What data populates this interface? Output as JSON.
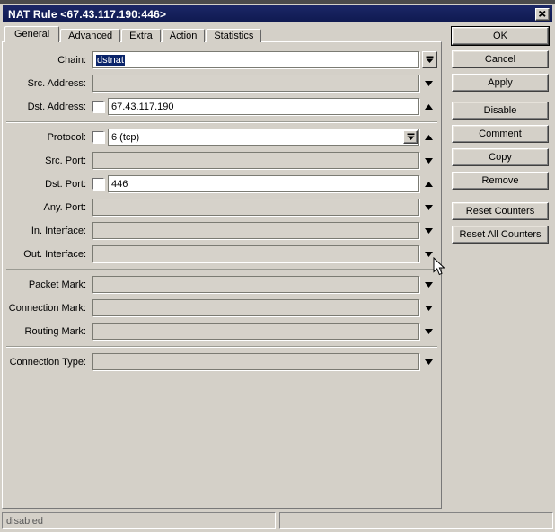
{
  "window": {
    "title": "NAT Rule <67.43.117.190:446>"
  },
  "tabs": [
    {
      "label": "General",
      "active": true
    },
    {
      "label": "Advanced",
      "active": false
    },
    {
      "label": "Extra",
      "active": false
    },
    {
      "label": "Action",
      "active": false
    },
    {
      "label": "Statistics",
      "active": false
    }
  ],
  "form": {
    "rows": [
      {
        "label": "Chain:",
        "value": "dstnat",
        "control": "combo-dropdown",
        "enabled": true,
        "selected": true
      },
      {
        "label": "Src. Address:",
        "value": "",
        "control": "expand-down",
        "enabled": false
      },
      {
        "label": "Dst. Address:",
        "value": "67.43.117.190",
        "control": "collapse-up",
        "enabled": true,
        "checkbox": false
      },
      {
        "label": "Protocol:",
        "value": "6 (tcp)",
        "control": "combo-and-collapse-up",
        "enabled": true,
        "checkbox": false
      },
      {
        "label": "Src. Port:",
        "value": "",
        "control": "expand-down",
        "enabled": false
      },
      {
        "label": "Dst. Port:",
        "value": "446",
        "control": "collapse-up",
        "enabled": true,
        "checkbox": false
      },
      {
        "label": "Any. Port:",
        "value": "",
        "control": "expand-down",
        "enabled": false
      },
      {
        "label": "In. Interface:",
        "value": "",
        "control": "expand-down",
        "enabled": false
      },
      {
        "label": "Out. Interface:",
        "value": "",
        "control": "expand-down",
        "enabled": false
      },
      {
        "label": "Packet Mark:",
        "value": "",
        "control": "expand-down",
        "enabled": false
      },
      {
        "label": "Connection Mark:",
        "value": "",
        "control": "expand-down",
        "enabled": false
      },
      {
        "label": "Routing Mark:",
        "value": "",
        "control": "expand-down",
        "enabled": false
      },
      {
        "label": "Connection Type:",
        "value": "",
        "control": "expand-down",
        "enabled": false
      }
    ]
  },
  "buttons": [
    "OK",
    "Cancel",
    "Apply",
    "Disable",
    "Comment",
    "Copy",
    "Remove",
    "Reset Counters",
    "Reset All Counters"
  ],
  "statusbar": {
    "left": "disabled",
    "right": ""
  },
  "icons": {
    "close-icon": "✕",
    "dropdown-icon": "⤓ (bar over down-triangle)",
    "triangle-up-icon": "▲",
    "triangle-down-icon": "▼"
  },
  "colors": {
    "titlebar": "#101a52",
    "dialog_bg": "#d4d0c8",
    "selection": "#0a246a",
    "field_white": "#ffffff",
    "status_text": "#5a5a5a"
  }
}
